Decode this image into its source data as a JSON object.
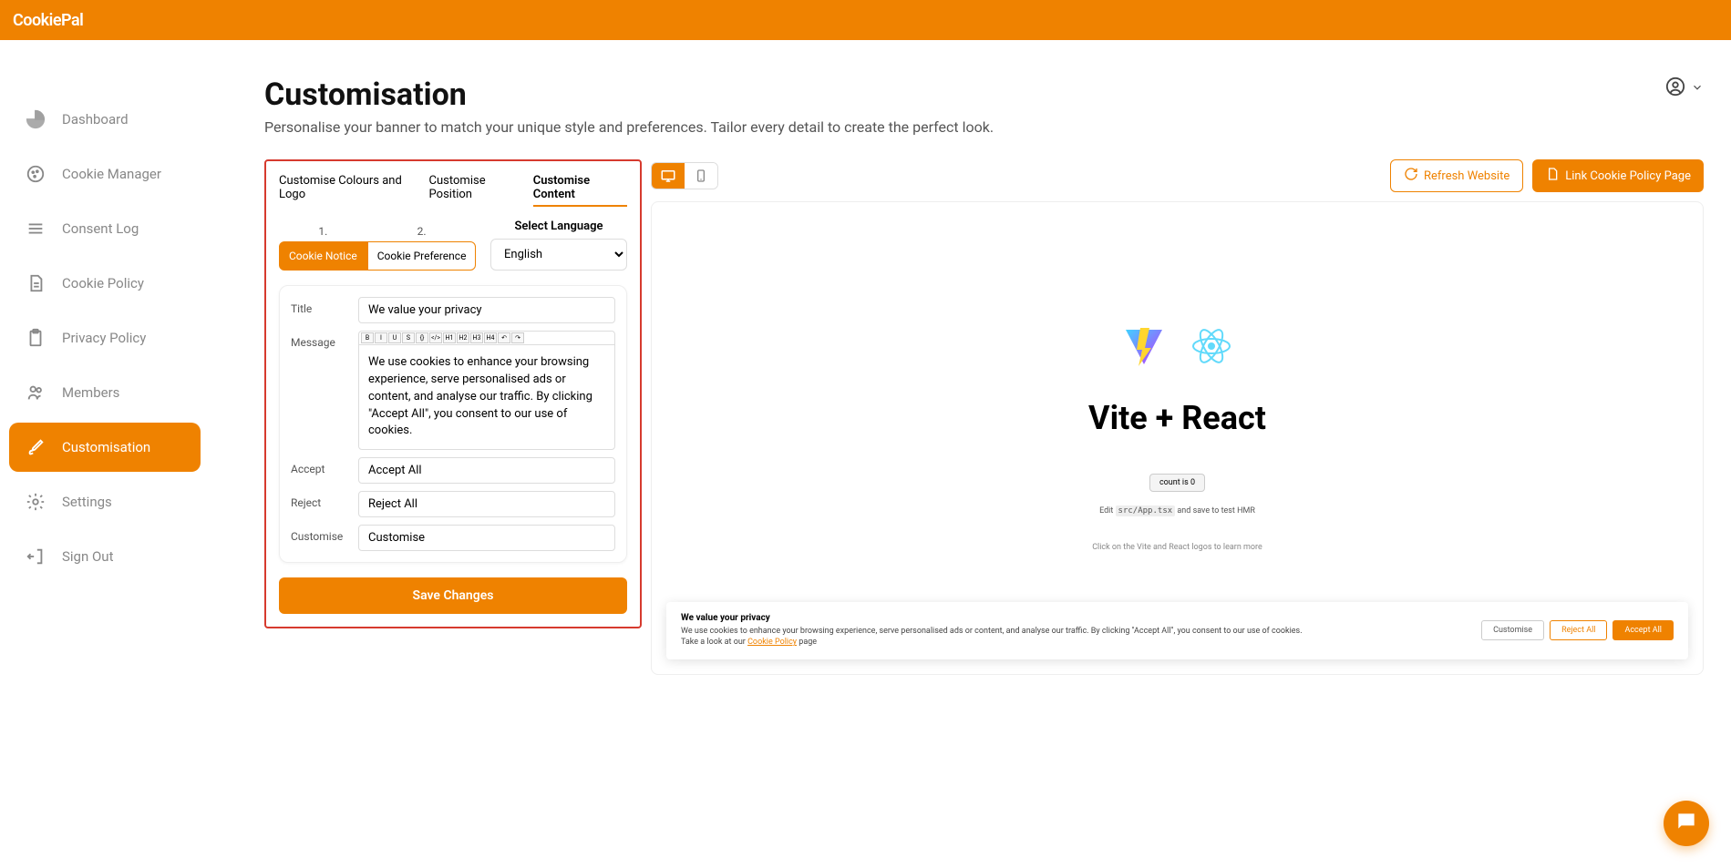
{
  "brand": "CookiePal",
  "sidebar": {
    "items": [
      {
        "label": "Dashboard"
      },
      {
        "label": "Cookie Manager"
      },
      {
        "label": "Consent Log"
      },
      {
        "label": "Cookie Policy"
      },
      {
        "label": "Privacy Policy"
      },
      {
        "label": "Members"
      },
      {
        "label": "Customisation"
      },
      {
        "label": "Settings"
      },
      {
        "label": "Sign Out"
      }
    ]
  },
  "page": {
    "title": "Customisation",
    "subtitle": "Personalise your banner to match your unique style and preferences. Tailor every detail to create the perfect look."
  },
  "tabs": {
    "colours": "Customise Colours and Logo",
    "position": "Customise Position",
    "content": "Customise Content"
  },
  "subtabs": {
    "num1": "1.",
    "num2": "2.",
    "notice": "Cookie Notice",
    "preference": "Cookie Preference"
  },
  "language": {
    "label": "Select Language",
    "value": "English"
  },
  "form": {
    "title_label": "Title",
    "title_value": "We value your privacy",
    "message_label": "Message",
    "message_value": "We use cookies to enhance your browsing experience, serve personalised ads or content, and analyse our traffic. By clicking \"Accept All\", you consent to our use of cookies.",
    "accept_label": "Accept",
    "accept_value": "Accept All",
    "reject_label": "Reject",
    "reject_value": "Reject All",
    "customise_label": "Customise",
    "customise_value": "Customise",
    "save": "Save Changes"
  },
  "editor_buttons": [
    "B",
    "I",
    "U",
    "S",
    "{}",
    "</>",
    "H1",
    "H2",
    "H3",
    "H4",
    "↶",
    "↷"
  ],
  "toolbar": {
    "refresh": "Refresh Website",
    "link_policy": "Link Cookie Policy Page"
  },
  "preview": {
    "title": "Vite + React",
    "count": "count is 0",
    "edit_pre": "Edit ",
    "edit_code": "src/App.tsx",
    "edit_post": " and save to test HMR",
    "hint": "Click on the Vite and React logos to learn more"
  },
  "banner": {
    "title": "We value your privacy",
    "desc_part1": "We use cookies to enhance your browsing experience, serve personalised ads or content, and analyse our traffic. By clicking \"Accept All\", you consent to our use of cookies.",
    "desc_part2a": "Take a look at our ",
    "desc_link": "Cookie Policy",
    "desc_part2b": " page",
    "customise": "Customise",
    "reject": "Reject All",
    "accept": "Accept All"
  }
}
